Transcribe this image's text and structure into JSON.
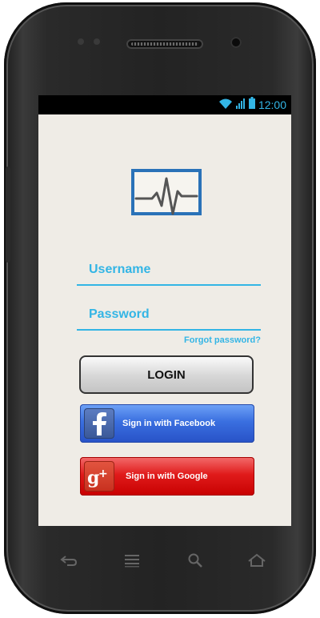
{
  "statusbar": {
    "time": "12:00",
    "wifi_icon": "wifi-icon",
    "signal_icon": "signal-icon",
    "battery_icon": "battery-icon"
  },
  "logo": {
    "icon": "heartbeat-monitor-icon"
  },
  "form": {
    "username_placeholder": "Username",
    "username_value": "",
    "password_placeholder": "Password",
    "password_value": "",
    "forgot_password": "Forgot password?",
    "login_label": "LOGIN"
  },
  "social": {
    "facebook_label": "Sign in with Facebook",
    "google_label": "Sign in with Google",
    "facebook_icon": "facebook-icon",
    "google_icon": "google-plus-icon"
  },
  "navbar": {
    "icons": [
      "back-icon",
      "menu-icon",
      "search-icon",
      "home-icon"
    ]
  },
  "colors": {
    "accent": "#33b5e5",
    "screen_bg": "#efece6",
    "facebook_blue": "#3a6fe0",
    "google_red": "#e01b1b",
    "logo_blue": "#2a72b8"
  }
}
